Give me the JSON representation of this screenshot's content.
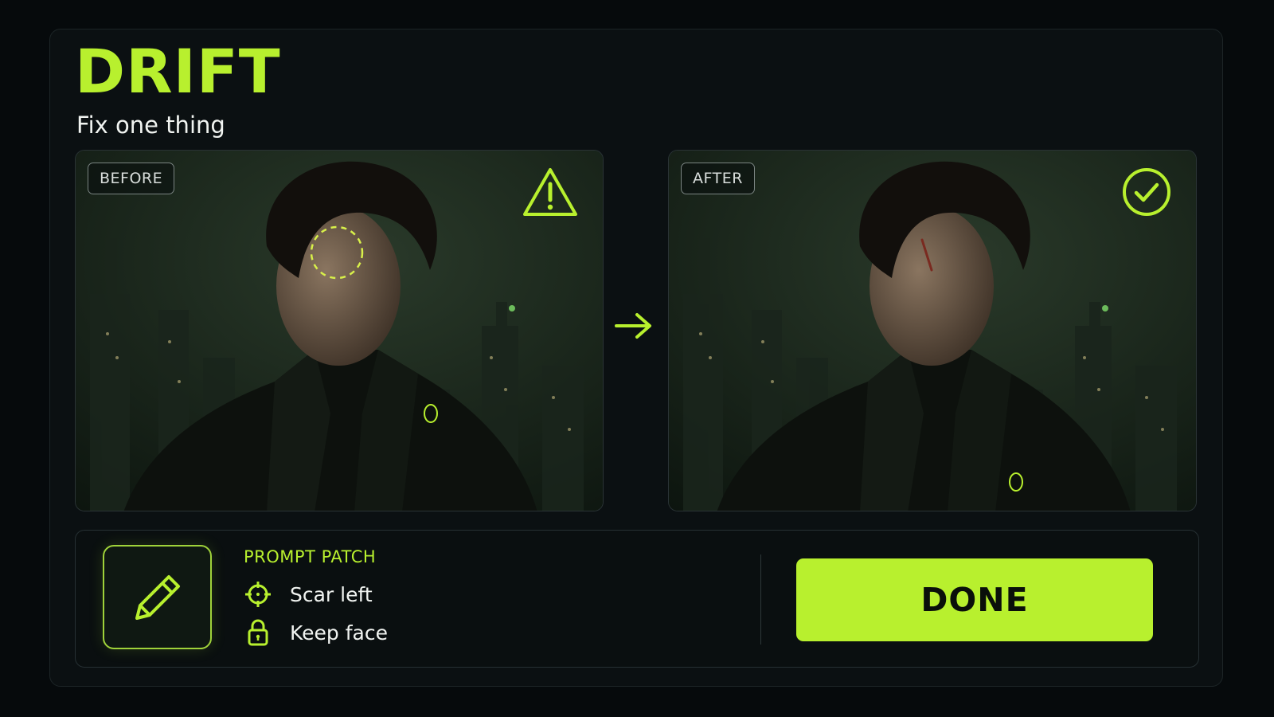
{
  "app": {
    "title": "DRIFT",
    "subtitle": "Fix one thing"
  },
  "comparison": {
    "before_label": "BEFORE",
    "after_label": "AFTER",
    "before_status_icon": "warning-triangle-icon",
    "after_status_icon": "check-circle-icon",
    "transition_icon": "arrow-right-icon"
  },
  "patch": {
    "section_label": "PROMPT PATCH",
    "edit_icon": "pencil-icon",
    "items": [
      {
        "icon": "crosshair-icon",
        "label": "Scar left"
      },
      {
        "icon": "lock-icon",
        "label": "Keep face"
      }
    ],
    "done_label": "DONE"
  },
  "colors": {
    "accent": "#b8f02e",
    "background": "#060a0c",
    "panel": "#0b1012"
  }
}
